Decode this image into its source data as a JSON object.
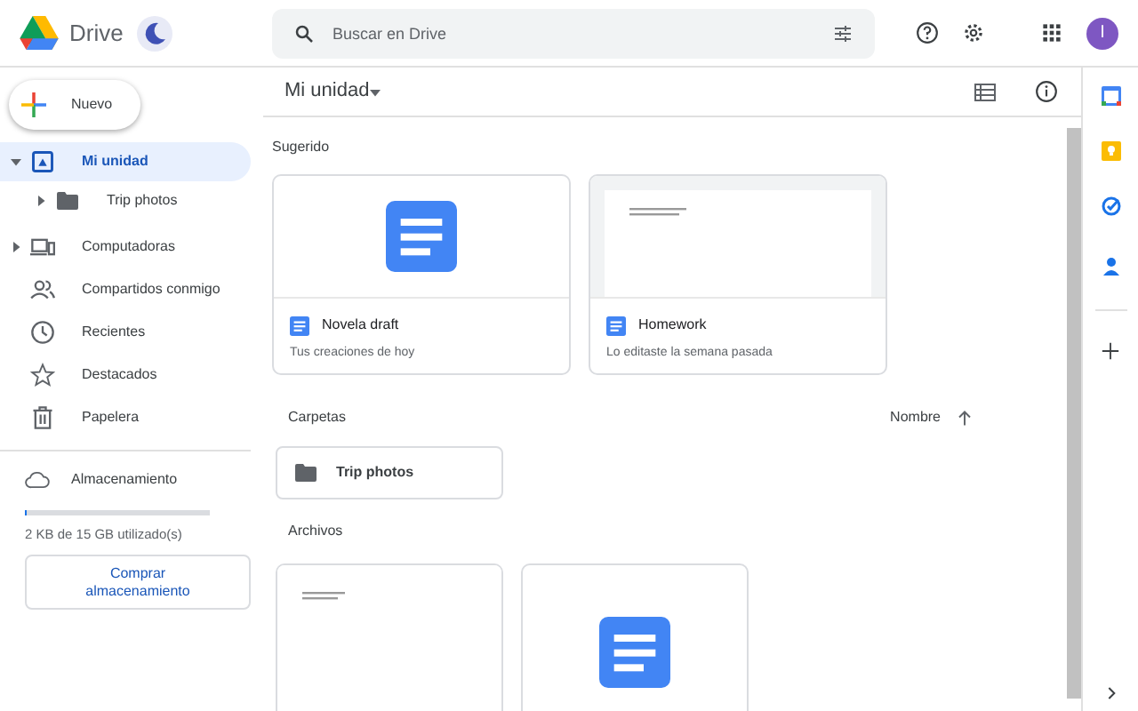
{
  "header": {
    "app_name": "Drive",
    "search": {
      "placeholder": "Buscar en Drive"
    },
    "avatar_letter": "I"
  },
  "sidebar": {
    "new_button": "Nuevo",
    "items": [
      {
        "kind": "tree",
        "label": "Mi unidad",
        "selected": true,
        "expanded": true,
        "children": [
          {
            "label": "Trip photos",
            "selected": false,
            "expanded": false
          }
        ]
      },
      {
        "kind": "tree",
        "label": "Computadoras",
        "selected": false,
        "expanded": false
      },
      {
        "kind": "shared",
        "label": "Compartidos conmigo",
        "selected": false
      },
      {
        "kind": "recent",
        "label": "Recientes",
        "selected": false
      },
      {
        "kind": "starred",
        "label": "Destacados",
        "selected": false
      },
      {
        "kind": "trash",
        "label": "Papelera",
        "selected": false
      }
    ],
    "storage": {
      "label": "Almacenamiento",
      "level": 0.002,
      "usage": "2 KB de 15 GB utilizado(s)",
      "buy_button": "Comprar almacenamiento"
    }
  },
  "main": {
    "title": "Mi unidad",
    "suggested": {
      "heading": "Sugerido",
      "cards": [
        {
          "kind": "doc-icon",
          "name": "Novela draft",
          "detail": "Tus creaciones de hoy"
        },
        {
          "kind": "doc-preview",
          "name": "Homework",
          "detail": "Lo editaste la semana pasada"
        }
      ]
    },
    "folders": {
      "heading": "Carpetas",
      "sort_label": "Nombre",
      "items": [
        "Trip photos"
      ]
    },
    "files": {
      "heading": "Archivos",
      "items": [
        {
          "kind": "doc-preview"
        },
        {
          "kind": "doc-icon"
        }
      ]
    }
  }
}
